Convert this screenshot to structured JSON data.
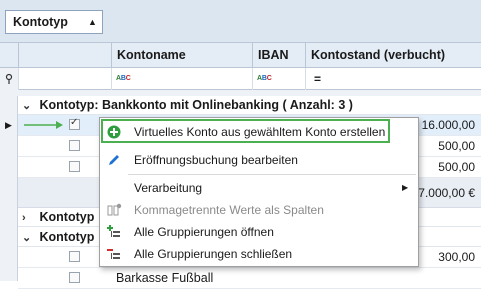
{
  "groupby": {
    "chip_label": "Kontotyp",
    "sort_arrow": "▲"
  },
  "columns": {
    "name": "Kontoname",
    "iban": "IBAN",
    "balance": "Kontostand (verbucht)"
  },
  "filter": {
    "text_filter_icon": "abc-filter-icon",
    "equals_symbol": "="
  },
  "groups": [
    {
      "label": "Kontotyp: Bankkonto mit Onlinebanking  ( Anzahl: 3 )"
    },
    {
      "label": "Kontotyp"
    },
    {
      "label": "Kontotyp"
    }
  ],
  "rows": [
    {
      "amount": "16.000,00",
      "checked": true
    },
    {
      "amount": "500,00",
      "checked": false
    },
    {
      "amount": "500,00",
      "checked": false
    }
  ],
  "summary": {
    "total": "7.000,00 €"
  },
  "lower_rows": [
    {
      "amount": "300,00",
      "checked": false
    },
    {
      "name": "Barkasse Fußball",
      "checked": false
    }
  ],
  "context_menu": {
    "items": [
      {
        "label": "Virtuelles Konto aus gewähltem Konto erstellen",
        "icon": "add-circle-icon"
      },
      {
        "label": "Eröffnungsbuchung bearbeiten",
        "icon": "pencil-icon"
      },
      {
        "label": "Verarbeitung",
        "icon": "",
        "submenu": "▶"
      },
      {
        "label": "Kommagetrennte Werte als Spalten",
        "icon": "split-columns-icon",
        "disabled": true
      },
      {
        "label": "Alle Gruppierungen öffnen",
        "icon": "expand-groups-icon"
      },
      {
        "label": "Alle Gruppierungen schließen",
        "icon": "collapse-groups-icon"
      }
    ]
  },
  "colors": {
    "accent_highlight": "#4caf50",
    "header_bg": "#e4ecf5",
    "groupbar_bg": "#dce6f1"
  }
}
